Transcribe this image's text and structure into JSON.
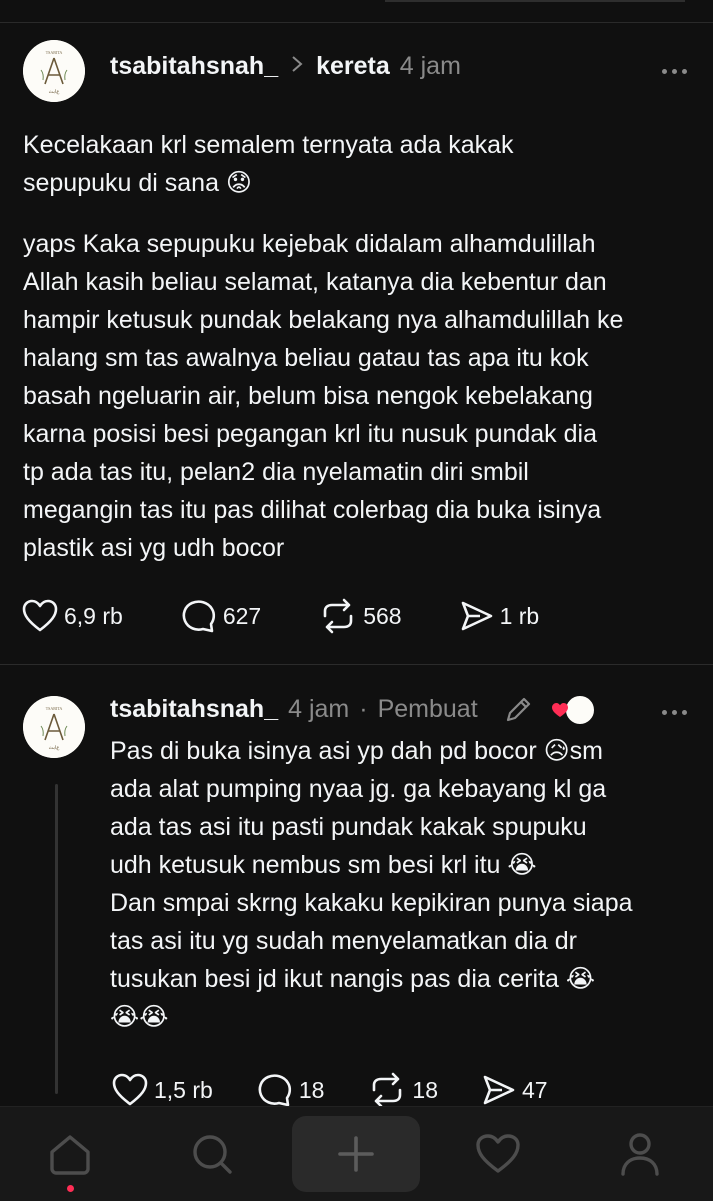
{
  "post1": {
    "username": "tsabitahsnah_",
    "topic": "kereta",
    "time": "4 jam",
    "para1": "Kecelakaan krl semalem ternyata ada kakak\nsepupuku di sana 😟",
    "para2": "yaps Kaka sepupuku kejebak didalam alhamdulillah\nAllah kasih beliau selamat, katanya dia kebentur dan\nhampir ketusuk pundak belakang nya alhamdulillah ke\nhalang sm tas awalnya beliau gatau tas apa itu kok\nbasah ngeluarin air, belum bisa nengok kebelakang\nkarna posisi besi pegangan krl itu nusuk pundak dia\ntp ada tas itu, pelan2 dia nyelamatin diri smbil\nmegangin tas itu pas dilihat colerbag dia buka isinya\nplastik asi yg udh bocor",
    "likes": "6,9 rb",
    "replies": "627",
    "reposts": "568",
    "shares": "1 rb"
  },
  "post2": {
    "username": "tsabitahsnah_",
    "time": "4 jam",
    "separator": "·",
    "creator_label": "Pembuat",
    "body": "Pas di buka isinya asi yp dah pd bocor 😥sm\nada alat pumping nyaa jg. ga kebayang kl ga\nada tas asi itu pasti pundak kakak spupuku\nudh ketusuk nembus sm besi krl itu 😭\nDan smpai skrng kakaku kepikiran punya siapa\ntas asi itu yg sudah menyelamatkan dia dr\ntusukan besi jd ikut nangis pas dia cerita 😭\n😭😭",
    "likes": "1,5 rb",
    "replies": "18",
    "reposts": "18",
    "shares": "47"
  },
  "colors": {
    "background": "#101010",
    "text": "#f3f5f7",
    "muted": "#8a8a8a",
    "nav_background": "#181818",
    "notification": "#ff2d55"
  },
  "icons": {
    "post_actions": [
      "heart-icon",
      "comment-icon",
      "repost-icon",
      "send-icon"
    ],
    "nav": [
      "home-icon",
      "search-icon",
      "plus-icon",
      "heart-icon",
      "profile-icon"
    ]
  }
}
